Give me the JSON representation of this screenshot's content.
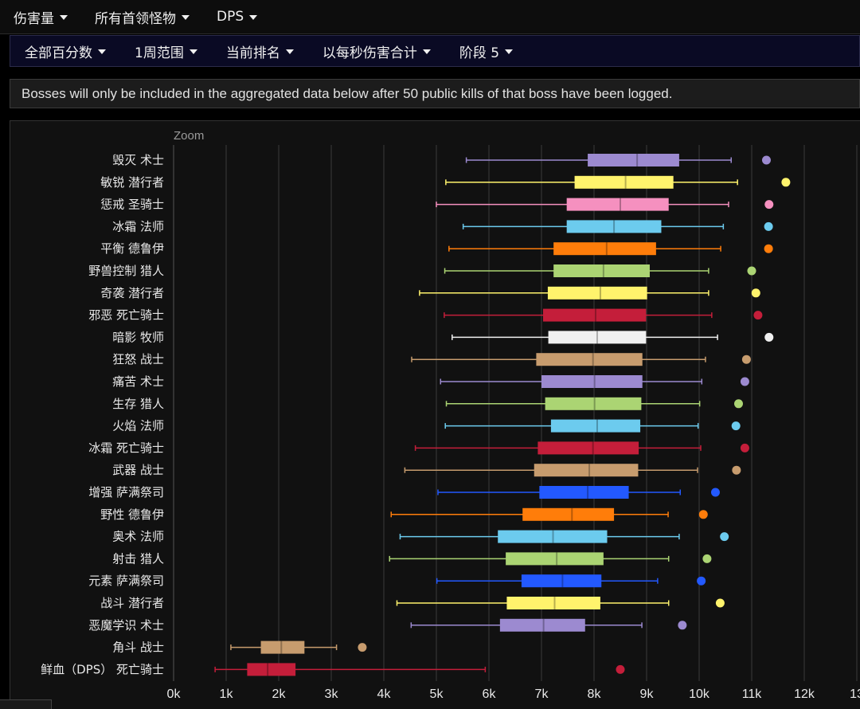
{
  "topbar": {
    "menus": [
      "伤害量",
      "所有首领怪物",
      "DPS"
    ]
  },
  "filters": {
    "menus": [
      "全部百分数",
      "1周范围",
      "当前排名",
      "以每秒伤害合计",
      "阶段 5"
    ]
  },
  "notice": "Bosses will only be included in the aggregated data below after 50 public kills of that boss have been logged.",
  "zoom_label": "Zoom",
  "chart_data": {
    "type": "boxplot",
    "orientation": "horizontal",
    "xlim": [
      0,
      13000
    ],
    "x_ticks": [
      {
        "value": 0,
        "label": "0k"
      },
      {
        "value": 1000,
        "label": "1k"
      },
      {
        "value": 2000,
        "label": "2k"
      },
      {
        "value": 3000,
        "label": "3k"
      },
      {
        "value": 4000,
        "label": "4k"
      },
      {
        "value": 5000,
        "label": "5k"
      },
      {
        "value": 6000,
        "label": "6k"
      },
      {
        "value": 7000,
        "label": "7k"
      },
      {
        "value": 8000,
        "label": "8k"
      },
      {
        "value": 9000,
        "label": "9k"
      },
      {
        "value": 10000,
        "label": "10k"
      },
      {
        "value": 11000,
        "label": "11k"
      },
      {
        "value": 12000,
        "label": "12k"
      },
      {
        "value": 13000,
        "label": "13"
      }
    ],
    "grid": true,
    "categories": [
      {
        "label": "毁灭 术士",
        "color": "#9c8ad0",
        "min": 5570,
        "q1": 7880,
        "median": 8820,
        "q3": 9620,
        "max": 10610,
        "outlier": 11280
      },
      {
        "label": "敏锐 潜行者",
        "color": "#fff36c",
        "min": 5180,
        "q1": 7630,
        "median": 8600,
        "q3": 9510,
        "max": 10730,
        "outlier": 11650
      },
      {
        "label": "惩戒 圣骑士",
        "color": "#f590bf",
        "min": 5000,
        "q1": 7480,
        "median": 8500,
        "q3": 9420,
        "max": 10560,
        "outlier": 11330
      },
      {
        "label": "冰霜 法师",
        "color": "#6ccbee",
        "min": 5510,
        "q1": 7480,
        "median": 8380,
        "q3": 9280,
        "max": 10460,
        "outlier": 11320
      },
      {
        "label": "平衡 德鲁伊",
        "color": "#ff7d0a",
        "min": 5240,
        "q1": 7230,
        "median": 8240,
        "q3": 9180,
        "max": 10410,
        "outlier": 11320
      },
      {
        "label": "野兽控制 猎人",
        "color": "#abd473",
        "min": 5160,
        "q1": 7230,
        "median": 8180,
        "q3": 9060,
        "max": 10180,
        "outlier": 11000
      },
      {
        "label": "奇袭 潜行者",
        "color": "#fff36c",
        "min": 4680,
        "q1": 7120,
        "median": 8120,
        "q3": 9010,
        "max": 10180,
        "outlier": 11080
      },
      {
        "label": "邪恶 死亡骑士",
        "color": "#c41e3a",
        "min": 5150,
        "q1": 7030,
        "median": 8030,
        "q3": 8990,
        "max": 10240,
        "outlier": 11120
      },
      {
        "label": "暗影 牧师",
        "color": "#f0f0f0",
        "min": 5300,
        "q1": 7130,
        "median": 8060,
        "q3": 8990,
        "max": 10350,
        "outlier": 11330
      },
      {
        "label": "狂怒 战士",
        "color": "#c79c6e",
        "min": 4530,
        "q1": 6900,
        "median": 7980,
        "q3": 8920,
        "max": 10120,
        "outlier": 10900
      },
      {
        "label": "痛苦 术士",
        "color": "#9c8ad0",
        "min": 5080,
        "q1": 7000,
        "median": 8010,
        "q3": 8920,
        "max": 10050,
        "outlier": 10870
      },
      {
        "label": "生存 猎人",
        "color": "#abd473",
        "min": 5190,
        "q1": 7070,
        "median": 8010,
        "q3": 8900,
        "max": 10010,
        "outlier": 10750
      },
      {
        "label": "火焰 法师",
        "color": "#6ccbee",
        "min": 5170,
        "q1": 7180,
        "median": 8060,
        "q3": 8880,
        "max": 9980,
        "outlier": 10700
      },
      {
        "label": "冰霜 死亡骑士",
        "color": "#c41e3a",
        "min": 4600,
        "q1": 6930,
        "median": 7980,
        "q3": 8850,
        "max": 10030,
        "outlier": 10870
      },
      {
        "label": "武器 战士",
        "color": "#c79c6e",
        "min": 4400,
        "q1": 6860,
        "median": 7910,
        "q3": 8840,
        "max": 9970,
        "outlier": 10710
      },
      {
        "label": "增强 萨满祭司",
        "color": "#2359ff",
        "min": 5030,
        "q1": 6960,
        "median": 7880,
        "q3": 8660,
        "max": 9640,
        "outlier": 10310
      },
      {
        "label": "野性 德鲁伊",
        "color": "#ff7d0a",
        "min": 4140,
        "q1": 6640,
        "median": 7580,
        "q3": 8380,
        "max": 9410,
        "outlier": 10080
      },
      {
        "label": "奥术 法师",
        "color": "#6ccbee",
        "min": 4310,
        "q1": 6170,
        "median": 7220,
        "q3": 8250,
        "max": 9620,
        "outlier": 10480
      },
      {
        "label": "射击 猎人",
        "color": "#abd473",
        "min": 4110,
        "q1": 6320,
        "median": 7290,
        "q3": 8180,
        "max": 9420,
        "outlier": 10150
      },
      {
        "label": "元素 萨满祭司",
        "color": "#2359ff",
        "min": 5010,
        "q1": 6620,
        "median": 7400,
        "q3": 8140,
        "max": 9210,
        "outlier": 10040
      },
      {
        "label": "战斗 潜行者",
        "color": "#fff36c",
        "min": 4250,
        "q1": 6340,
        "median": 7250,
        "q3": 8120,
        "max": 9420,
        "outlier": 10400
      },
      {
        "label": "恶魔学识 术士",
        "color": "#9c8ad0",
        "min": 4520,
        "q1": 6210,
        "median": 7040,
        "q3": 7830,
        "max": 8910,
        "outlier": 9680
      },
      {
        "label": "角斗 战士",
        "color": "#c79c6e",
        "min": 1090,
        "q1": 1660,
        "median": 2050,
        "q3": 2490,
        "max": 3100,
        "outlier": 3590
      },
      {
        "label": "鲜血（DPS） 死亡骑士",
        "color": "#c41e3a",
        "min": 790,
        "q1": 1400,
        "median": 1790,
        "q3": 2320,
        "max": 5930,
        "outlier": 8500
      }
    ]
  }
}
